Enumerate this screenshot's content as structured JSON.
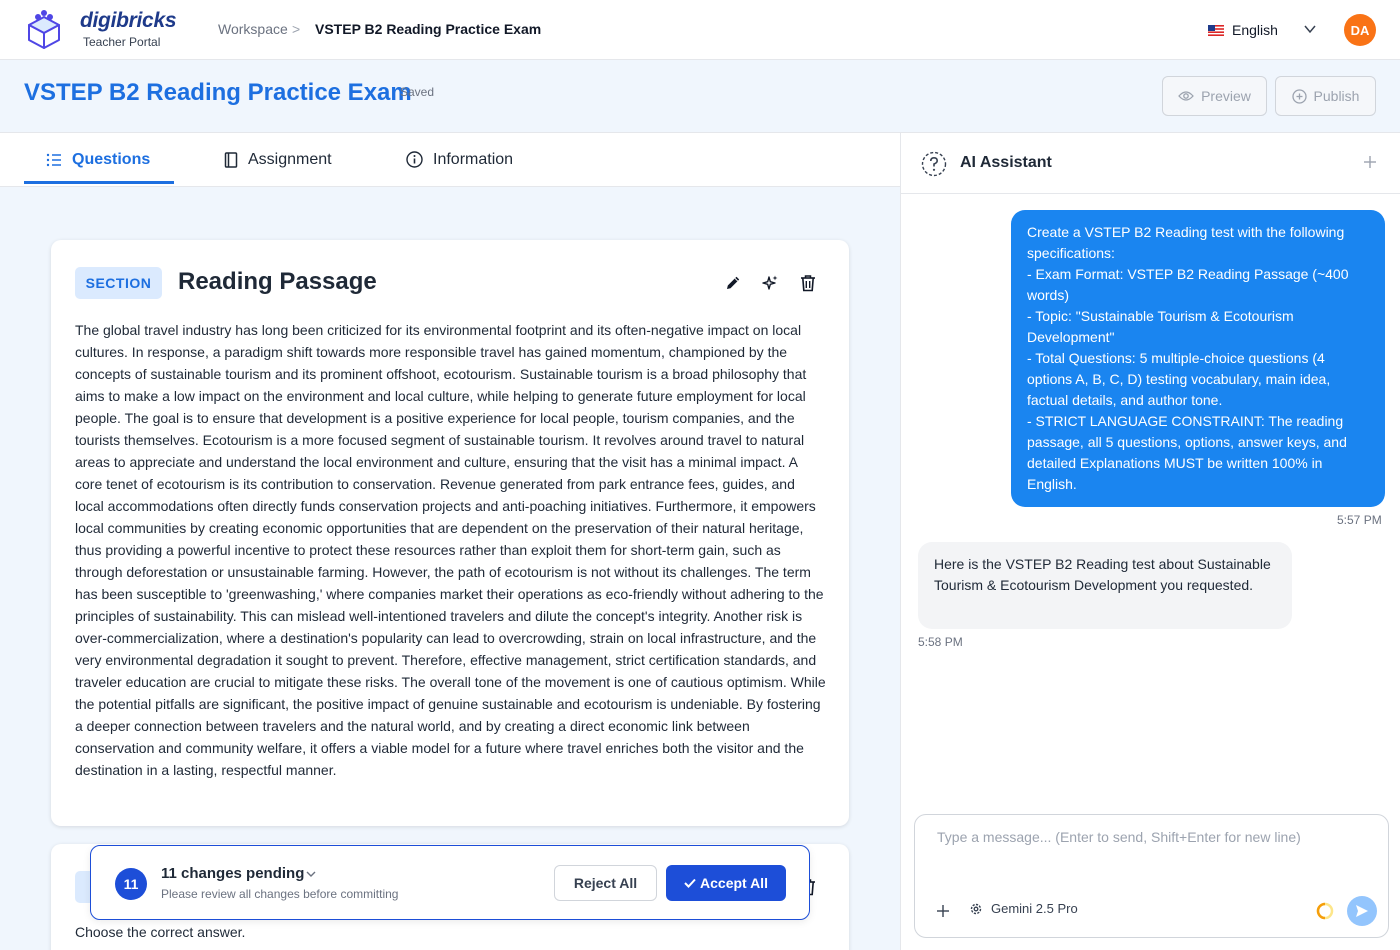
{
  "app": {
    "brand": "digibricks",
    "subtitle": "Teacher Portal"
  },
  "breadcrumb": {
    "workspace": "Workspace",
    "separator": ">",
    "current": "VSTEP B2 Reading Practice Exam"
  },
  "language": {
    "label": "English",
    "flag_icon": "us-flag-icon"
  },
  "user": {
    "initials": "DA",
    "avatar_color": "#f97316"
  },
  "page": {
    "title": "VSTEP B2 Reading Practice Exam",
    "status": "Saved",
    "preview_label": "Preview",
    "publish_label": "Publish"
  },
  "tabs": [
    {
      "label": "Questions",
      "icon": "list-icon",
      "active": true
    },
    {
      "label": "Assignment",
      "icon": "book-icon",
      "active": false
    },
    {
      "label": "Information",
      "icon": "info-icon",
      "active": false
    }
  ],
  "section": {
    "badge": "SECTION",
    "title": "Reading Passage",
    "passage": "The global travel industry has long been criticized for its environmental footprint and its often-negative impact on local cultures. In response, a paradigm shift towards more responsible travel has gained momentum, championed by the concepts of sustainable tourism and its prominent offshoot, ecotourism. Sustainable tourism is a broad philosophy that aims to make a low impact on the environment and local culture, while helping to generate future employment for local people. The goal is to ensure that development is a positive experience for local people, tourism companies, and the tourists themselves. Ecotourism is a more focused segment of sustainable tourism. It revolves around travel to natural areas to appreciate and understand the local environment and culture, ensuring that the visit has a minimal impact. A core tenet of ecotourism is its contribution to conservation. Revenue generated from park entrance fees, guides, and local accommodations often directly funds conservation projects and anti-poaching initiatives. Furthermore, it empowers local communities by creating economic opportunities that are dependent on the preservation of their natural heritage, thus providing a powerful incentive to protect these resources rather than exploit them for short-term gain, such as through deforestation or unsustainable farming. However, the path of ecotourism is not without its challenges. The term has been susceptible to 'greenwashing,' where companies market their operations as eco-friendly without adhering to the principles of sustainability. This can mislead well-intentioned travelers and dilute the concept's integrity. Another risk is over-commercialization, where a destination's popularity can lead to overcrowding, strain on local infrastructure, and the very environmental degradation it sought to prevent. Therefore, effective management, strict certification standards, and traveler education are crucial to mitigate these risks. The overall tone of the movement is one of cautious optimism. While the potential pitfalls are significant, the positive impact of genuine sustainable and ecotourism is undeniable. By fostering a deeper connection between travelers and the natural world, and by creating a direct economic link between conservation and community welfare, it offers a viable model for a future where travel enriches both the visitor and the destination in a lasting, respectful manner."
  },
  "question_card": {
    "instruction": "Choose the correct answer."
  },
  "pending": {
    "count": "11",
    "title": "11 changes pending",
    "subtitle": "Please review all changes before committing",
    "reject_label": "Reject All",
    "accept_label": "Accept All"
  },
  "assistant": {
    "title": "AI Assistant",
    "messages": [
      {
        "role": "user",
        "lines": [
          "Create a VSTEP B2 Reading test with the following specifications:",
          "- Exam Format: VSTEP B2 Reading Passage (~400 words)",
          "- Topic: \"Sustainable Tourism & Ecotourism Development\"",
          "- Total Questions: 5 multiple-choice questions (4 options A, B, C, D) testing vocabulary, main idea, factual details, and author tone.",
          "- STRICT LANGUAGE CONSTRAINT: The reading passage, all 5 questions, options, answer keys, and detailed Explanations MUST be written 100% in English."
        ],
        "time": "5:57 PM"
      },
      {
        "role": "assistant",
        "text": "Here is the VSTEP B2 Reading test about Sustainable Tourism & Ecotourism Development you requested.",
        "time": "5:58 PM"
      }
    ],
    "input_placeholder": "Type a message... (Enter to send, Shift+Enter for new line)",
    "model": "Gemini 2.5 Pro"
  },
  "colors": {
    "accent": "#1d6fe0",
    "primary_button": "#1d4ed8",
    "user_bubble": "#1a85f0"
  }
}
